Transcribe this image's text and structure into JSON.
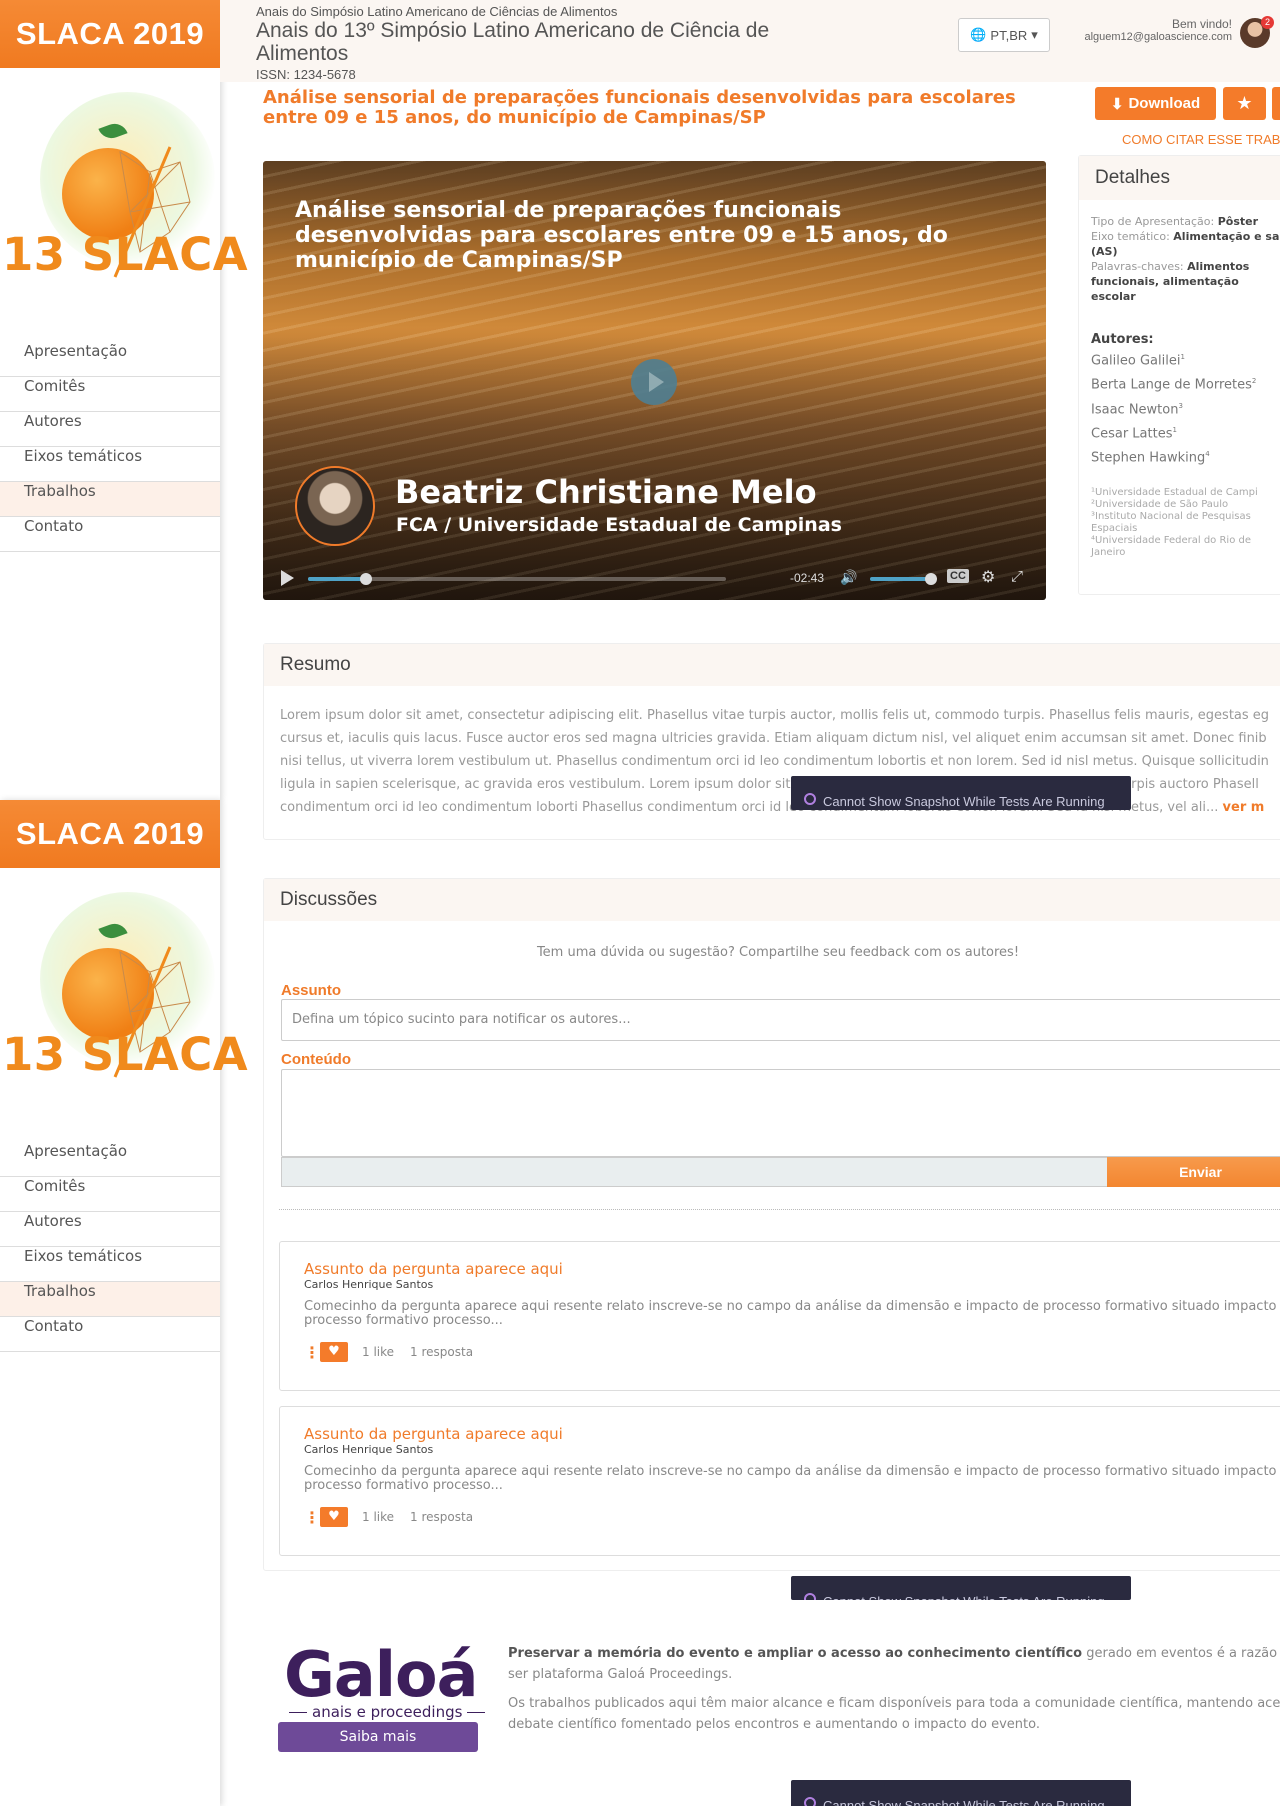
{
  "sidebar": {
    "event_label": "SLACA 2019",
    "logo_text": "13 SLACA",
    "menu": [
      "Apresentação",
      "Comitês",
      "Autores",
      "Eixos temáticos",
      "Trabalhos",
      "Contato"
    ],
    "active_item": "Trabalhos"
  },
  "header": {
    "subtitle": "Anais do Simpósio Latino Americano de Ciências de Alimentos",
    "title": "Anais do 13º Simpósio Latino Americano de Ciência de Alimentos",
    "issn": "ISSN: 1234-5678",
    "language": "PT,BR",
    "welcome": "Bem vindo!",
    "email": "alguem12@galoascience.com",
    "notification_count": "2"
  },
  "article": {
    "title": "Análise sensorial de preparações funcionais desenvolvidas para escolares entre 09 e 15 anos, do município de Campinas/SP",
    "download_label": "Download",
    "cite_label": "COMO CITAR ESSE TRAB"
  },
  "video": {
    "title": "Análise sensorial de preparações funcionais desenvolvidas para escolares entre 09 e 15 anos, do município de Campinas/SP",
    "speaker_name": "Beatriz Christiane Melo",
    "speaker_affiliation": "FCA / Universidade Estadual de Campinas",
    "time_remaining": "-02:43",
    "cc_label": "CC"
  },
  "details": {
    "heading": "Detalhes",
    "presentation_type_label": "Tipo de Apresentação:",
    "presentation_type": "Pôster",
    "axis_label": "Eixo temático:",
    "axis_line1": "Alimentação e sa",
    "axis_line2": "(AS)",
    "keywords_label": "Palavras-chaves:",
    "keywords_line1": "Alimentos",
    "keywords_line2": "funcionais, alimentação escolar",
    "authors_heading": "Autores:",
    "authors": [
      {
        "name": "Galileo Galilei",
        "ref": "1"
      },
      {
        "name": "Berta Lange de Morretes",
        "ref": "2"
      },
      {
        "name": "Isaac Newton",
        "ref": "3"
      },
      {
        "name": "Cesar Lattes",
        "ref": "1"
      },
      {
        "name": "Stephen Hawking",
        "ref": "4"
      }
    ],
    "institutions": [
      "¹Universidade Estadual de Campi",
      "²Universidade de São Paulo",
      "³Instituto Nacional de Pesquisas",
      "Espaciais",
      "⁴Universidade Federal do Rio de",
      "Janeiro"
    ]
  },
  "resumo": {
    "heading": "Resumo",
    "lines": [
      "Lorem ipsum dolor sit amet, consectetur adipiscing elit. Phasellus vitae turpis auctor, mollis felis ut, commodo turpis. Phasellus felis mauris, egestas eg",
      "cursus et, iaculis quis lacus. Fusce auctor eros sed magna ultricies gravida. Etiam aliquam dictum nisl, vel aliquet enim accumsan sit amet. Donec finib",
      "nisi tellus, ut viverra lorem vestibulum ut. Phasellus condimentum orci id leo condimentum lobortis et non lorem. Sed id nisl metus. Quisque sollicitudin",
      "ligula in sapien scelerisque, ac gravida eros vestibulum. Lorem ipsum dolor sit amet, consectetur adipiscing elit. Phasellus vitae turpis auctoro Phasell",
      "condimentum orci id leo condimentum loborti Phasellus condimentum orci id leo condimentum lobortis et non lorem. Sed id nisl metus, vel ali... "
    ],
    "more_label": "ver m"
  },
  "snapshot_notice": "Cannot Show Snapshot While Tests Are Running",
  "discussions": {
    "heading": "Discussões",
    "intro": "Tem uma dúvida ou sugestão? Compartilhe seu feedback com os autores!",
    "subject_label": "Assunto",
    "subject_placeholder": "Defina um tópico sucinto para notificar os autores...",
    "content_label": "Conteúdo",
    "send_label": "Enviar",
    "questions": [
      {
        "title": "Assunto da pergunta aparece aqui",
        "author": "Carlos Henrique Santos",
        "body": "Comecinho da pergunta aparece aqui resente relato inscreve-se no campo da análise da dimensão e impacto de processo formativo situado impacto de processo formativo processo...",
        "likes": "1 like",
        "replies": "1 resposta"
      },
      {
        "title": "Assunto da pergunta aparece aqui",
        "author": "Carlos Henrique Santos",
        "body": "Comecinho da pergunta aparece aqui resente relato inscreve-se no campo da análise da dimensão e impacto de processo formativo situado impacto de processo formativo processo...",
        "likes": "1 like",
        "replies": "1 resposta"
      }
    ]
  },
  "footer": {
    "brand": "Galoá",
    "brand_sub": "anais e proceedings",
    "saiba_label": "Saiba mais",
    "p1_bold": "Preservar a memória do evento e ampliar o acesso ao conhecimento científico",
    "p1_rest": " gerado em eventos é a razão de ser plataforma Galoá Proceedings.",
    "p2": "Os trabalhos publicados aqui têm maior alcance e ficam disponíveis para toda a comunidade científica, mantendo aces debate científico fomentado pelos encontros e aumentando o impacto do evento."
  },
  "colors": {
    "accent": "#f07b2a",
    "brand_purple": "#3d1f5c"
  }
}
